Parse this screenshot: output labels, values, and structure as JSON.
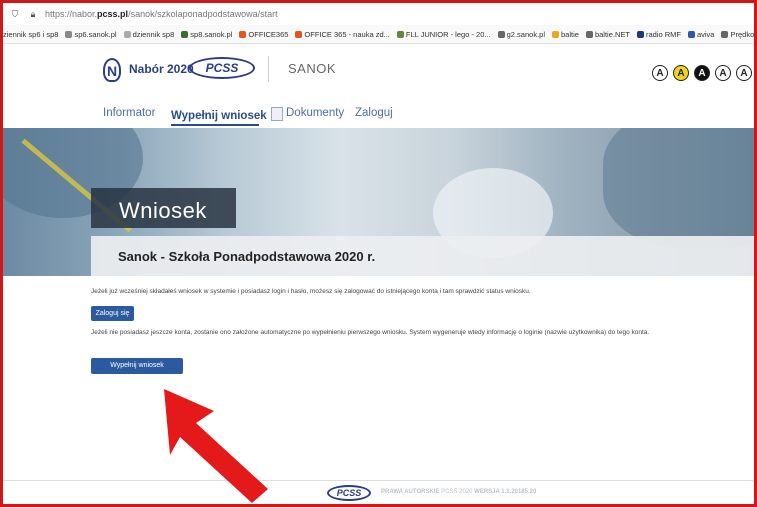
{
  "browser": {
    "url_prefix": "https://nabor.",
    "url_domain": "pcss.pl",
    "url_path": "/sanok/szkolaponadpodstawowa/start",
    "bookmarks": [
      {
        "label": "ziennik sp6 i sp8",
        "color": ""
      },
      {
        "label": "sp6.sanok.pl",
        "color": "#888888"
      },
      {
        "label": "dziennik sp8",
        "color": "#aaaaaa"
      },
      {
        "label": "sp8.sanok.pl",
        "color": "#3b6e2c"
      },
      {
        "label": "OFFICE365",
        "color": "#e5541b"
      },
      {
        "label": "OFFICE 365 - nauka zd...",
        "color": "#e5541b"
      },
      {
        "label": "FLL JUNIOR - lego - 20...",
        "color": "#5a8a3a"
      },
      {
        "label": "g2.sanok.pl",
        "color": "#666666"
      },
      {
        "label": "baltie",
        "color": "#e8a81a"
      },
      {
        "label": "baltie.NET",
        "color": "#666666"
      },
      {
        "label": "radio RMF",
        "color": "#1a3b7a"
      },
      {
        "label": "aviva",
        "color": "#2a5aa8"
      },
      {
        "label": "Prędkość INTER",
        "color": "#666666"
      }
    ]
  },
  "header": {
    "logo_letter": "N",
    "brand": "Nabór 2020",
    "pcss_logo": "PCSS",
    "city": "SANOK",
    "contrast_buttons": [
      {
        "label": "A",
        "bg": "#ffffff",
        "fg": "#222222"
      },
      {
        "label": "A",
        "bg": "#f2d51b",
        "fg": "#222222"
      },
      {
        "label": "A",
        "bg": "#111111",
        "fg": "#ffffff"
      },
      {
        "label": "A",
        "bg": "#ffffff",
        "fg": "#222222"
      },
      {
        "label": "A",
        "bg": "#ffffff",
        "fg": "#222222"
      }
    ]
  },
  "nav": {
    "items": [
      {
        "label": "Informator"
      },
      {
        "label": "Wypełnij wniosek"
      },
      {
        "label": "Dokumenty"
      },
      {
        "label": "Zaloguj"
      }
    ]
  },
  "hero": {
    "title": "Wniosek",
    "subtitle": "Sanok - Szkoła Ponadpodstawowa 2020 r."
  },
  "content": {
    "paragraph1": "Jeżeli już wcześniej składałeś wniosek w systemie i posiadasz login i hasło, możesz się zalogować do istniejącego konta i tam sprawdzić status wniosku.",
    "login_button": "Zaloguj się",
    "paragraph2": "Jeżeli nie posiadasz jeszcze konta, zostanie ono założone automatyczne po wypełnieniu pierwszego wniosku. System wygeneruje wtedy informację o loginie (nazwie użytkownika) do tego konta.",
    "fill_button": "Wypełnij wniosek"
  },
  "footer": {
    "pcss_logo": "PCSS",
    "copyright_label": "PRAWA AUTORSKIE",
    "copyright_value": "PCSS 2020",
    "version": "WERSJA 1.1.20185.20"
  },
  "colors": {
    "primary_blue": "#2c5aa0",
    "annotation_red": "#e41a1a"
  }
}
